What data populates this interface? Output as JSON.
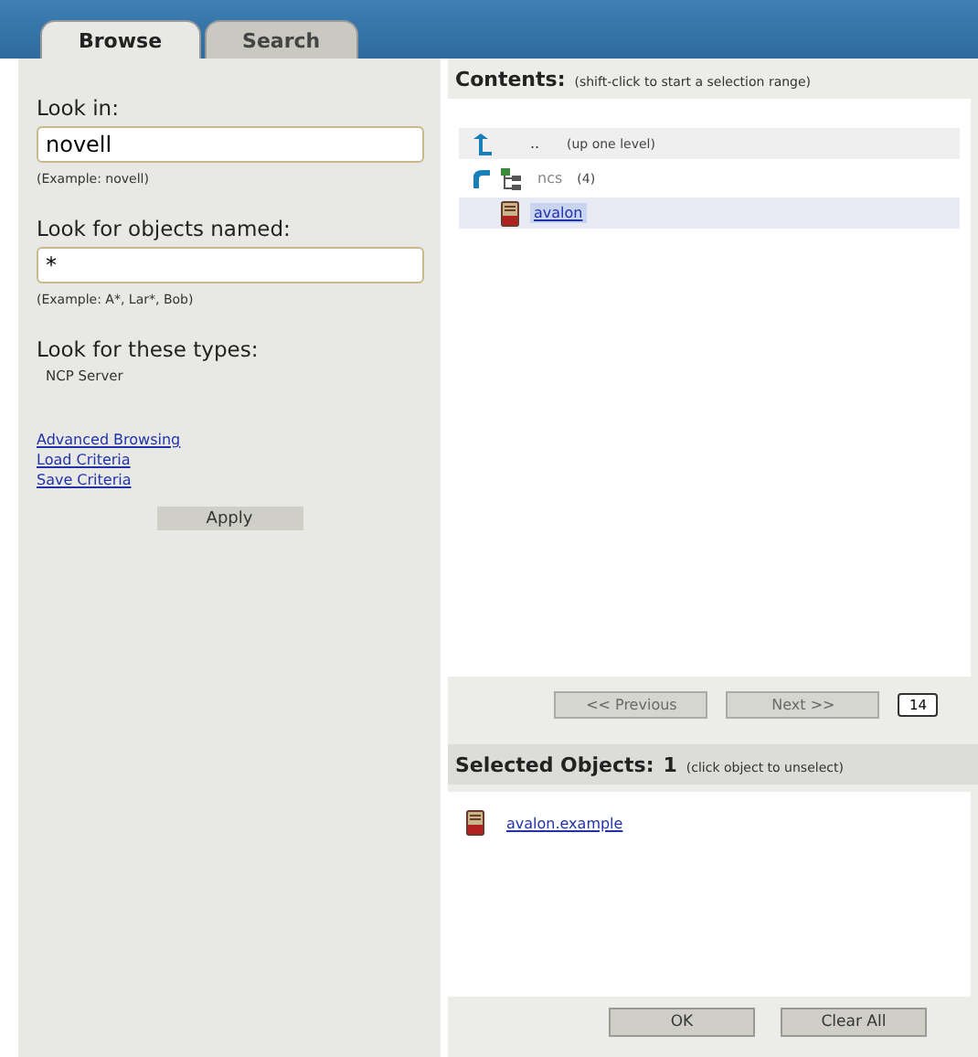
{
  "tabs": [
    {
      "label": "Browse",
      "selected": true
    },
    {
      "label": "Search",
      "selected": false
    }
  ],
  "left": {
    "look_in": {
      "label": "Look in:",
      "value": "novell",
      "example": "(Example: novell)"
    },
    "named": {
      "label": "Look for objects named:",
      "value": "*",
      "example": "(Example: A*, Lar*, Bob)"
    },
    "types": {
      "label": "Look for these types:",
      "items": [
        "NCP Server"
      ]
    },
    "links": [
      "Advanced Browsing",
      "Load Criteria",
      "Save Criteria"
    ],
    "apply": "Apply"
  },
  "contents": {
    "title": "Contents:",
    "hint": "(shift-click to start a selection range)",
    "items": [
      {
        "kind": "up",
        "name": "..",
        "note": "(up one level)",
        "selected": false
      },
      {
        "kind": "container",
        "name": "ncs",
        "note": "(4)",
        "selected": false
      },
      {
        "kind": "server",
        "name": "avalon",
        "selected": true
      }
    ],
    "pager": {
      "previous": {
        "label": "<< Previous",
        "disabled": true
      },
      "next": {
        "label": "Next >>",
        "disabled": true
      },
      "page_size": "14"
    }
  },
  "selected_objects": {
    "title": "Selected Objects:",
    "count": "1",
    "hint": "(click object to unselect)",
    "items": [
      "avalon.example"
    ]
  },
  "buttons": [
    "OK",
    "Clear All"
  ]
}
